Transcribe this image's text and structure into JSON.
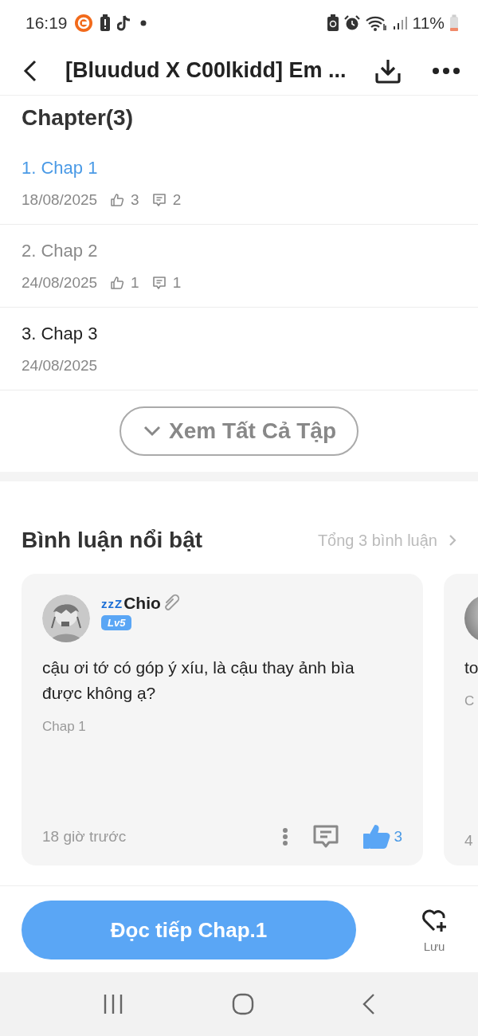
{
  "status_bar": {
    "time": "16:19",
    "battery": "11%"
  },
  "header": {
    "title": "[Bluudud X C00lkidd] Em ..."
  },
  "chapters": {
    "heading": "Chapter(3)",
    "items": [
      {
        "title": "1. Chap 1",
        "date": "18/08/2025",
        "likes": "3",
        "comments": "2",
        "kind": "current"
      },
      {
        "title": "2. Chap 2",
        "date": "24/08/2025",
        "likes": "1",
        "comments": "1",
        "kind": "read"
      },
      {
        "title": "3. Chap 3",
        "date": "24/08/2025",
        "kind": "unread"
      }
    ],
    "see_all": "Xem Tất Cả Tập"
  },
  "comments": {
    "heading": "Bình luận nổi bật",
    "total": "Tổng 3 bình luận",
    "cards": [
      {
        "name_prefix": "zzZ",
        "name": "Chio",
        "level": "Lv5",
        "text": "cậu ơi tớ có góp ý xíu, là cậu thay ảnh bìa được không ạ?",
        "chapter": "Chap 1",
        "time": "18 giờ trước",
        "likes": "3",
        "liked": true
      },
      {
        "text": "to",
        "chapter": "C",
        "time": "4"
      }
    ]
  },
  "bottom": {
    "read_button": "Đọc tiếp Chap.1",
    "save": "Lưu"
  }
}
